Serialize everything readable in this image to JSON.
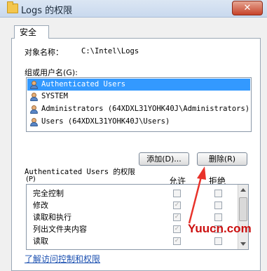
{
  "window": {
    "title": "Logs 的权限",
    "close_glyph": "✕"
  },
  "tabs": [
    {
      "label": "安全"
    }
  ],
  "object": {
    "label": "对象名称：",
    "value": "C:\\Intel\\Logs"
  },
  "groups": {
    "label": "组或用户名(G):",
    "items": [
      {
        "name": "Authenticated Users",
        "selected": true
      },
      {
        "name": "SYSTEM",
        "selected": false
      },
      {
        "name": "Administrators (64XDXL31YOHK40J\\Administrators)",
        "selected": false
      },
      {
        "name": "Users (64XDXL31YOHK40J\\Users)",
        "selected": false
      }
    ]
  },
  "buttons": {
    "add": "添加(D)...",
    "remove": "删除(R)"
  },
  "permissions": {
    "title": "Authenticated Users 的权限",
    "shortcut": "(P)",
    "allow_header": "允许",
    "deny_header": "拒绝",
    "rows": [
      {
        "name": "完全控制",
        "allow": false,
        "deny": false
      },
      {
        "name": "修改",
        "allow": true,
        "deny": false
      },
      {
        "name": "读取和执行",
        "allow": true,
        "deny": false
      },
      {
        "name": "列出文件夹内容",
        "allow": true,
        "deny": false
      },
      {
        "name": "读取",
        "allow": true,
        "deny": false
      }
    ]
  },
  "link": "了解访问控制和权限",
  "watermark": "Yuucn.com",
  "colors": {
    "selection": "#3399ff",
    "arrow": "#e8322a",
    "watermark": "#cc1010"
  }
}
